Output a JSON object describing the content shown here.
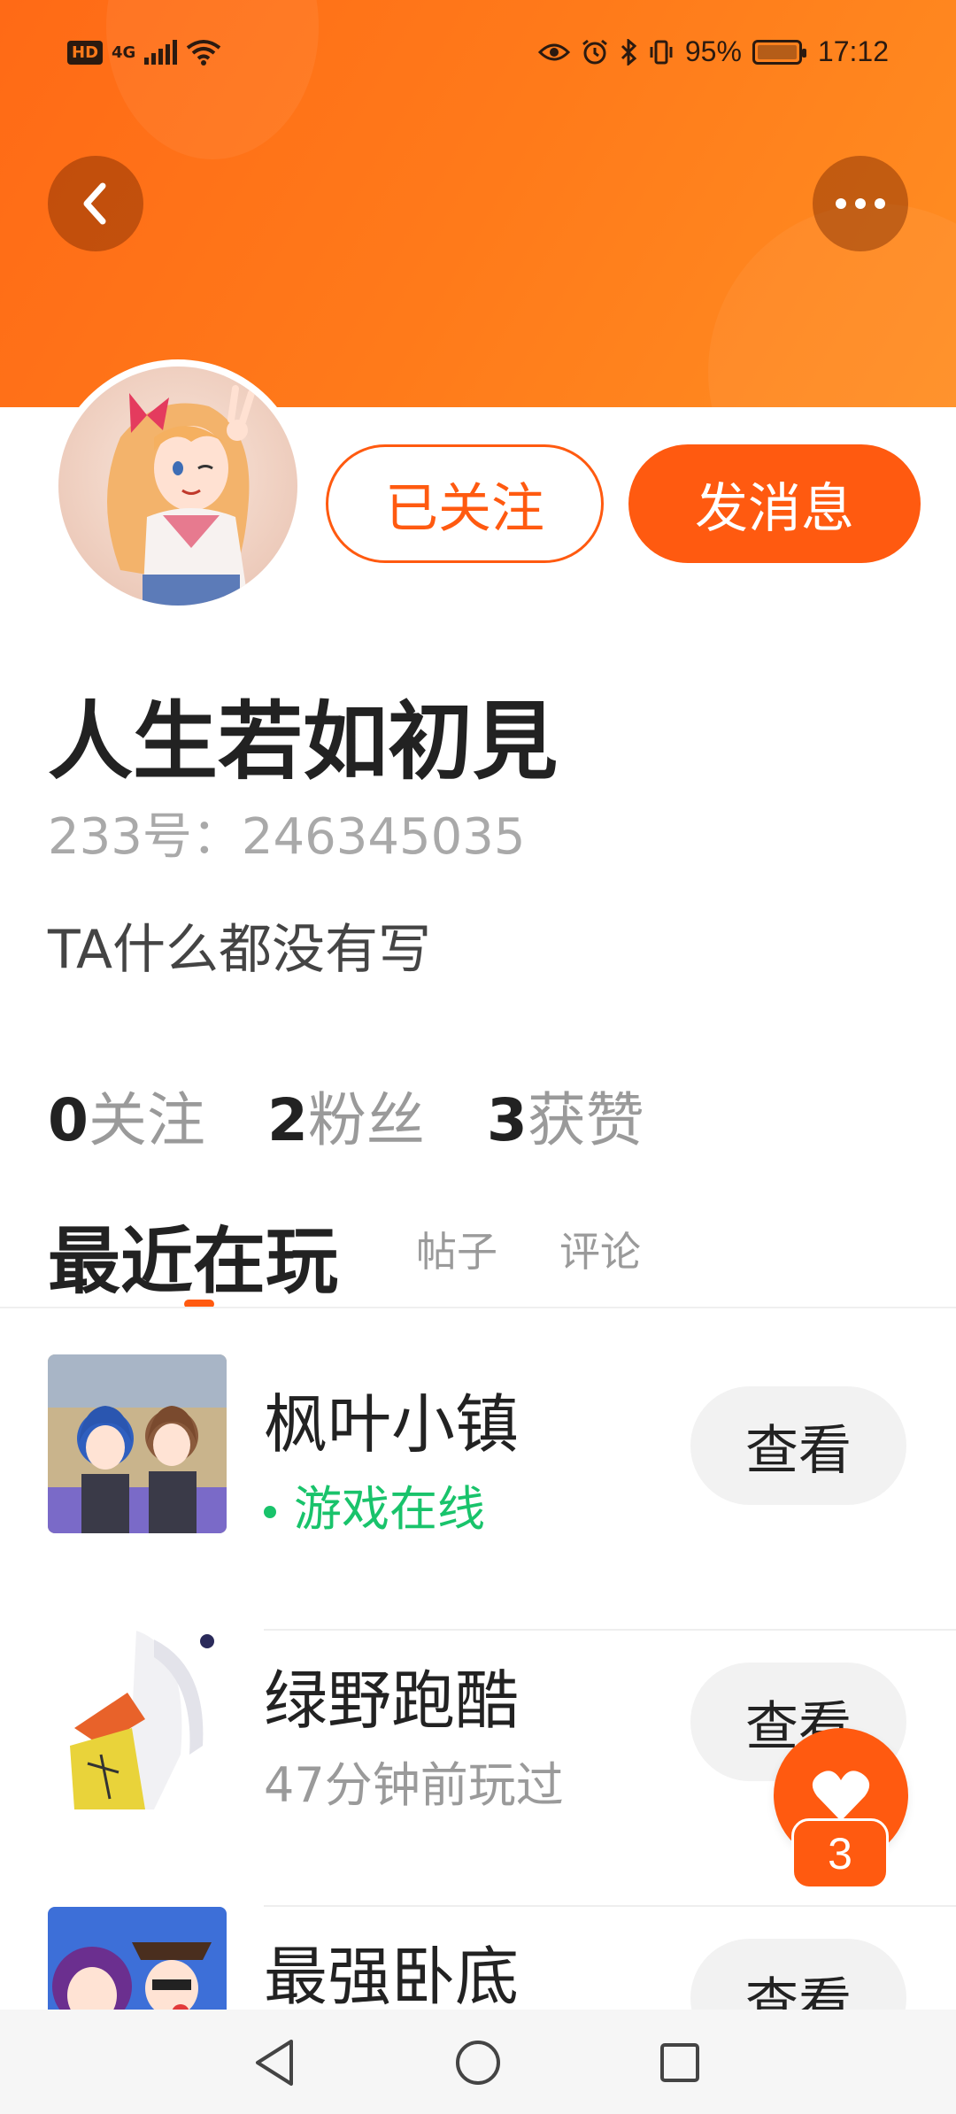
{
  "status_bar": {
    "hd_label": "HD",
    "network_label": "4G",
    "battery_percent": "95%",
    "time": "17:12"
  },
  "header": {
    "back_icon": "chevron-left-icon",
    "more_icon": "more-dots-icon"
  },
  "profile": {
    "followed_label": "已关注",
    "message_label": "发消息",
    "username": "人生若如初見",
    "uid": "233号：246345035",
    "bio": "TA什么都没有写",
    "stats": [
      {
        "num": "0",
        "label": "关注"
      },
      {
        "num": "2",
        "label": "粉丝"
      },
      {
        "num": "3",
        "label": "获赞"
      }
    ]
  },
  "tabs": {
    "active": "最近在玩",
    "posts": "帖子",
    "comments": "评论"
  },
  "games": [
    {
      "title": "枫叶小镇",
      "status": "游戏在线",
      "online": true,
      "button": "查看"
    },
    {
      "title": "绿野跑酷",
      "status": "47分钟前玩过",
      "online": false,
      "button": "查看"
    },
    {
      "title": "最强卧底",
      "status": "",
      "online": false,
      "button": "查看"
    }
  ],
  "like_fab": {
    "icon": "heart-icon",
    "count": "3"
  },
  "colors": {
    "accent": "#ff5a10",
    "online": "#19c36b",
    "header_start": "#ff6a16",
    "header_end": "#ff8e22"
  }
}
